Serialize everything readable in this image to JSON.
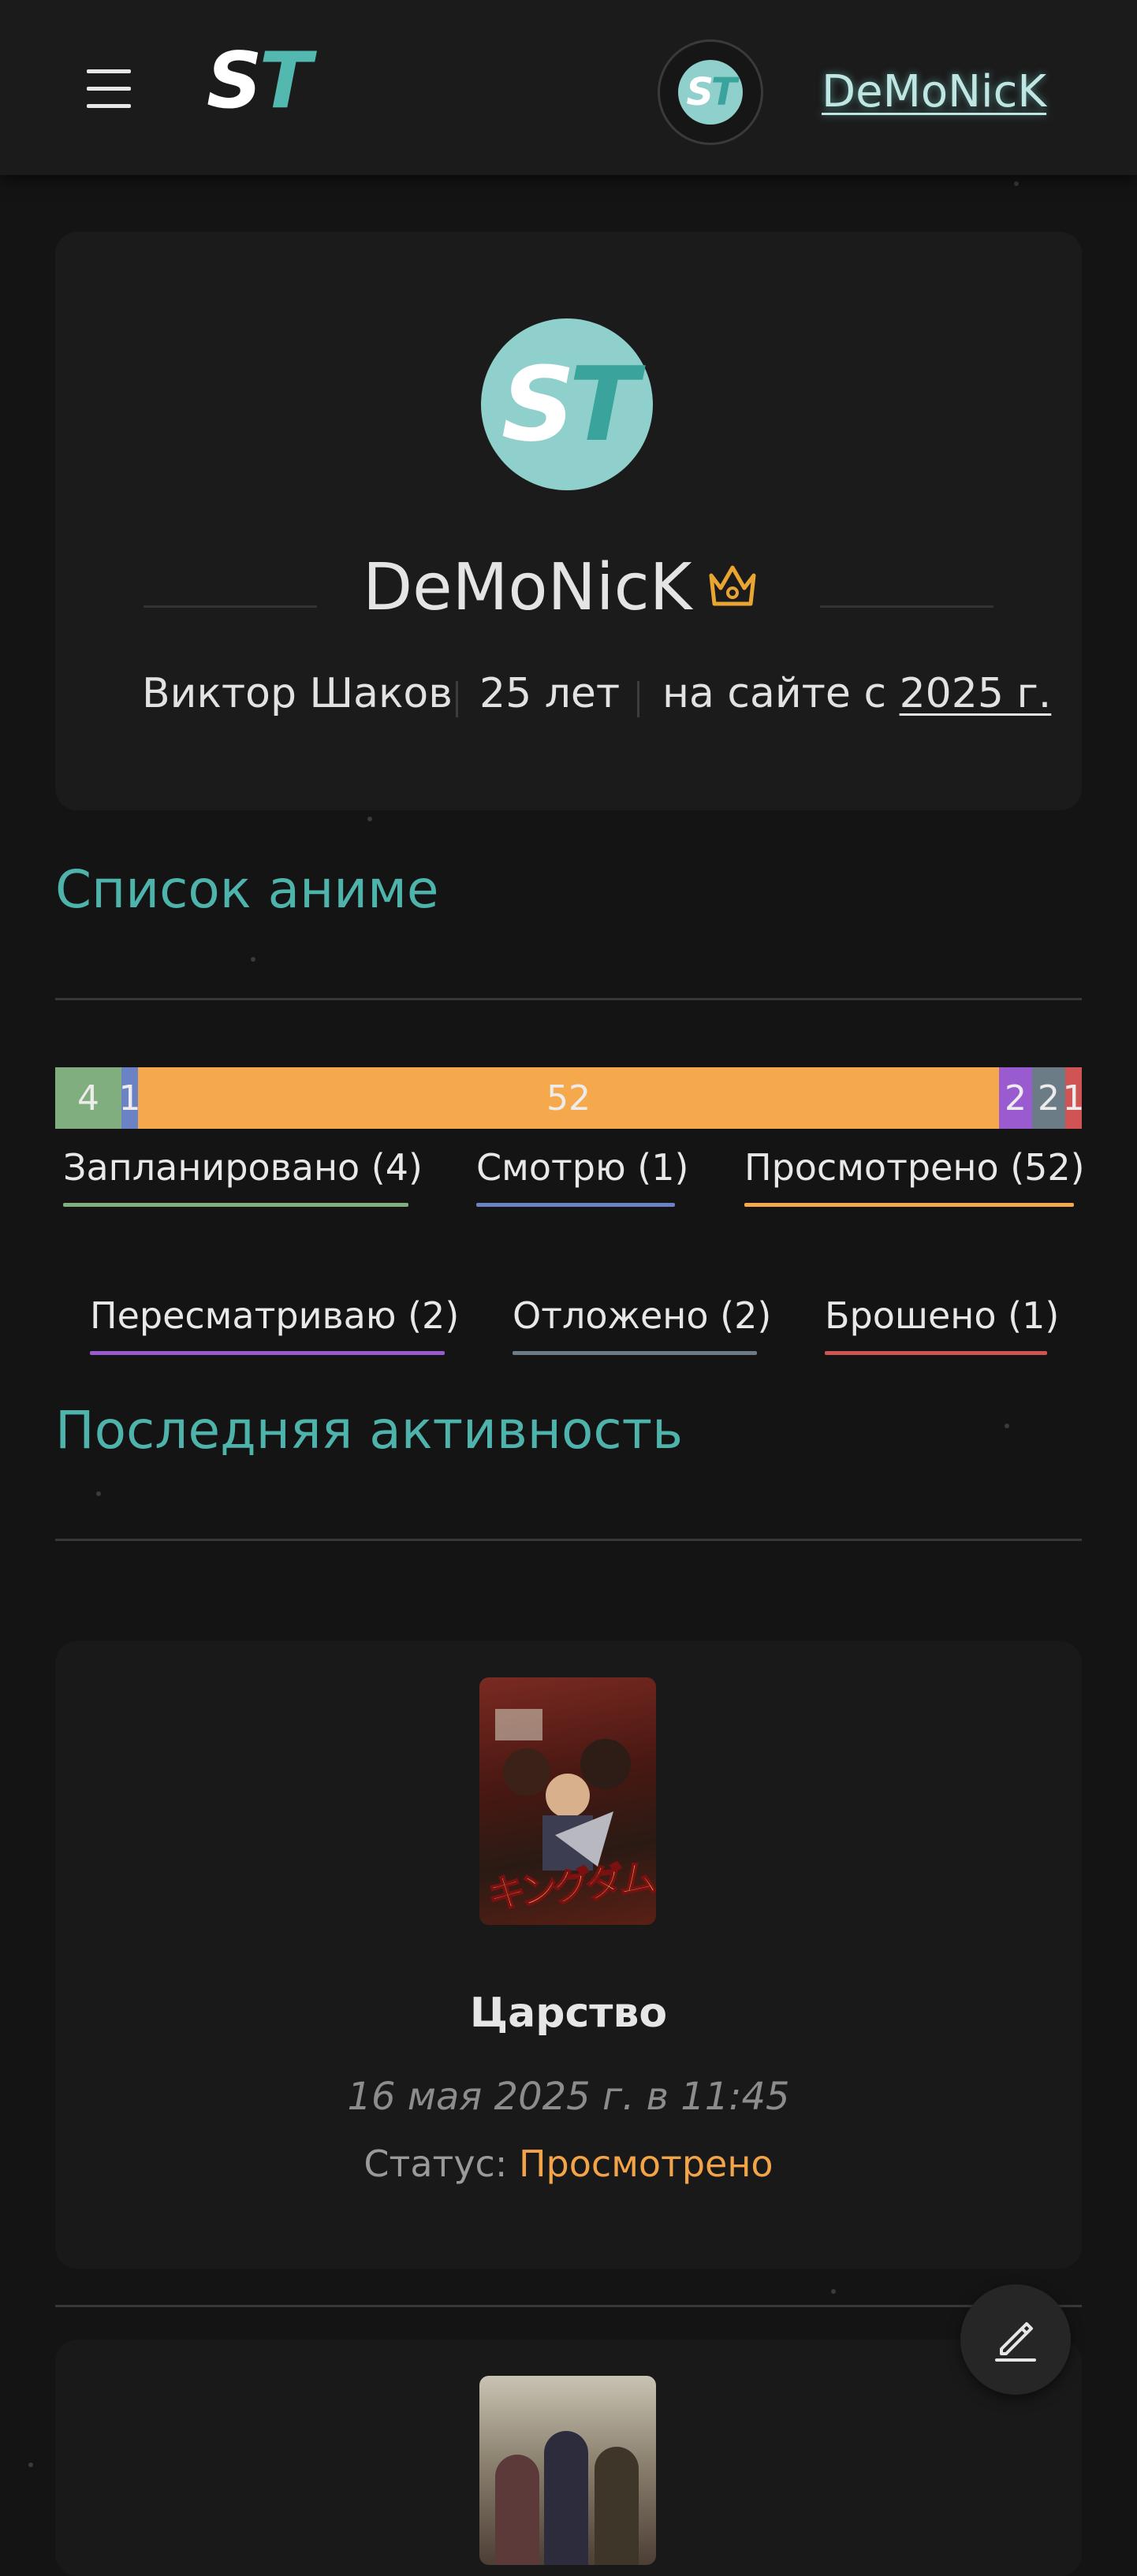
{
  "header": {
    "logo": {
      "s": "S",
      "t": "T"
    },
    "avatar": {
      "s": "S",
      "t": "T"
    },
    "username": "DeMoNicK",
    "icons": {
      "menu": "hamburger-icon"
    }
  },
  "profile": {
    "avatar": {
      "s": "S",
      "t": "T"
    },
    "nickname": "DeMoNicK",
    "crown_icon": "crown-icon",
    "full_name": "Виктор Шаков",
    "age": "25 лет",
    "since_label": "на сайте с",
    "since_year": "2025 г."
  },
  "anime_list": {
    "title": "Список аниме",
    "stats": [
      {
        "key": "planned",
        "label": "Запланировано (4)",
        "count": 4,
        "bar_label": "4",
        "color": "#80ae7e"
      },
      {
        "key": "watching",
        "label": "Смотрю (1)",
        "count": 1,
        "bar_label": "1",
        "color": "#6b82c4"
      },
      {
        "key": "completed",
        "label": "Просмотрено (52)",
        "count": 52,
        "bar_label": "52",
        "color": "#f6a84c"
      },
      {
        "key": "rewatching",
        "label": "Пересматриваю (2)",
        "count": 2,
        "bar_label": "2",
        "color": "#9a5bd0"
      },
      {
        "key": "on_hold",
        "label": "Отложено (2)",
        "count": 2,
        "bar_label": "2",
        "color": "#6c7c86"
      },
      {
        "key": "dropped",
        "label": "Брошено (1)",
        "count": 1,
        "bar_label": "1",
        "color": "#d05454"
      }
    ]
  },
  "activity": {
    "title": "Последняя активность",
    "items": [
      {
        "title": "Царство",
        "date": "16 мая 2025 г. в 11:45",
        "status_label": "Статус:",
        "status_value": "Просмотрено",
        "poster_text": "キングダム"
      }
    ]
  },
  "fab": {
    "icon": "pencil-icon"
  }
}
